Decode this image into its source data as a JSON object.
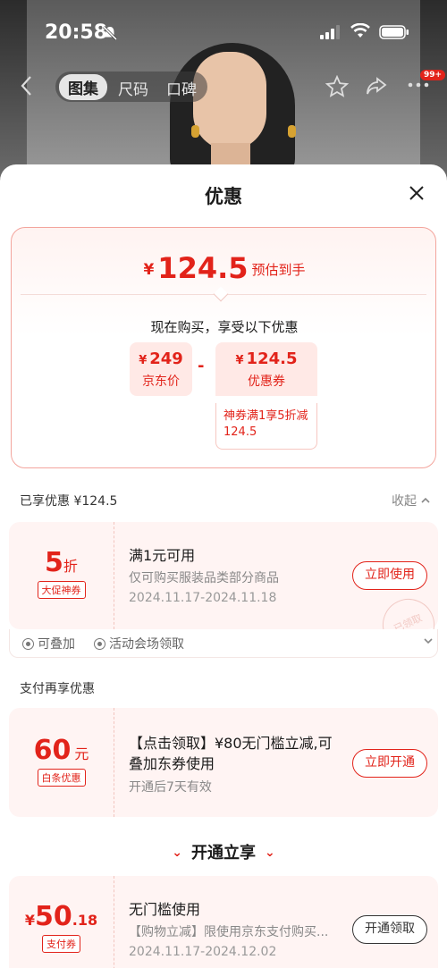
{
  "status_bar": {
    "time": "20:58"
  },
  "nav": {
    "tabs": [
      "图集",
      "尺码",
      "口碑"
    ],
    "badge": "99+"
  },
  "sheet": {
    "title": "优惠",
    "estimate": {
      "yen": "¥",
      "amount": "124.5",
      "suffix": "预估到手",
      "subtitle": "现在购买，享受以下优惠",
      "minus": "-",
      "calc": [
        {
          "value": "249",
          "label": "京东价"
        },
        {
          "value": "124.5",
          "label": "优惠券"
        }
      ],
      "coupon_note": "神券满1享5折减124.5"
    },
    "enjoyed_section": {
      "label": "已享优惠 ¥124.5",
      "collapse": "收起"
    },
    "coupon1": {
      "value": "5",
      "unit": "折",
      "tag": "大促神券",
      "title": "满1元可用",
      "desc": "仅可购买服装品类部分商品",
      "date": "2024.11.17-2024.11.18",
      "button": "立即使用",
      "stamp": "已领取"
    },
    "coupon1_features": [
      "可叠加",
      "活动会场领取"
    ],
    "pay_section": {
      "label": "支付再享优惠"
    },
    "coupon2": {
      "value": "60",
      "unit": "元",
      "tag": "白条优惠",
      "title": "【点击领取】¥80无门槛立减,可叠加东券使用",
      "desc": "开通后7天有效",
      "button": "立即开通"
    },
    "promo_heading": "开通立享",
    "coupon3": {
      "yen": "¥",
      "value_int": "50",
      "value_dec": ".18",
      "tag": "支付券",
      "title": "无门槛使用",
      "desc": "【购物立减】限使用京东支付购买...",
      "date": "2024.11.17-2024.12.02",
      "button": "开通领取"
    }
  },
  "colors": {
    "accent": "#e2231a",
    "card_bg": "#fff4f3"
  }
}
